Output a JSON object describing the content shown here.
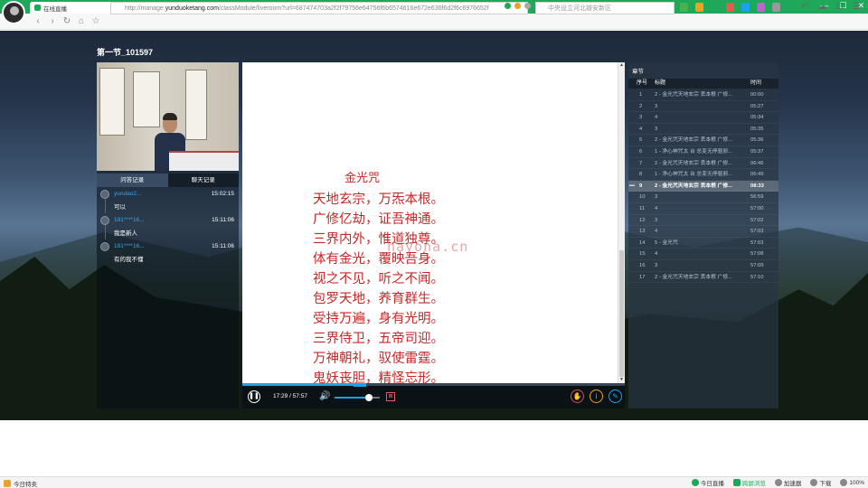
{
  "browser": {
    "tab_label": "在线直播",
    "tab_close": "×",
    "new_tab": "+",
    "url_prefix": "http://manage.",
    "url_domain": "yunduoketang.com",
    "url_rest": "/classModule/liveroom?url=687474703a2f2f79756e64756f6b6574616e672e636f6d2f6c6976652f",
    "search_text": "中央设立河北雄安新区",
    "nav": {
      "back": "‹",
      "forward": "›",
      "reload": "↻",
      "home": "⌂",
      "star": "☆"
    },
    "win_controls": {
      "min": "—",
      "max": "☐",
      "close": "✕"
    },
    "right_icons": {
      "undo": "↶",
      "cloud": "☁",
      "crop": "⊡",
      "menu": "☰"
    },
    "colors": {
      "brand": "#1fa85a"
    }
  },
  "course": {
    "title": "第一节_101597"
  },
  "chat": {
    "tabs": [
      {
        "label": "问答记录"
      },
      {
        "label": "聊天记录"
      }
    ],
    "messages": [
      {
        "user": "yundao2...",
        "time": "15:02:15",
        "text": "可以"
      },
      {
        "user": "181****16...",
        "time": "15:11:06",
        "text": "我是新人"
      },
      {
        "user": "181****16...",
        "time": "15:11:06",
        "text": "有的我不懂"
      }
    ]
  },
  "doc": {
    "title": "金光咒",
    "lines": [
      "天地玄宗，万炁本根。",
      "广修亿劫，证吾神通。",
      "三界内外，惟道独尊。",
      "体有金光，覆映吾身。",
      "视之不见，听之不闻。",
      "包罗天地，养育群生。",
      "受持万遍，身有光明。",
      "三界侍卫，五帝司迎。",
      "万神朝礼，驭使雷霆。",
      "鬼妖丧胆，精怪忘形。"
    ],
    "watermark": "hayona.cn",
    "scroll_up": "▲",
    "scroll_down": "▼"
  },
  "player": {
    "time": "17:29 / 57:57",
    "progress": 0.302,
    "volume": 0.75,
    "pause_glyph": "❚❚",
    "volume_glyph": "🔊",
    "cc_glyph": "⊠",
    "hand_glyph": "✋",
    "info_glyph": "i",
    "pen_glyph": "✎",
    "colors": {
      "accent": "#1aa3e8"
    }
  },
  "chapters": {
    "title": "章节",
    "headers": {
      "no": "序号",
      "title": "标题",
      "time": "时间"
    },
    "current_marker": "•••",
    "rows": [
      {
        "no": "1",
        "title": "2 - 金光咒天地玄宗 丢本根 广修...",
        "time": "00:00",
        "current": false
      },
      {
        "no": "2",
        "title": "3",
        "time": "05:27",
        "current": false
      },
      {
        "no": "3",
        "title": "4",
        "time": "05:34",
        "current": false
      },
      {
        "no": "4",
        "title": "3",
        "time": "05:35",
        "current": false
      },
      {
        "no": "5",
        "title": "2 - 金光咒天地玄宗 丢本根 广修...",
        "time": "05:36",
        "current": false
      },
      {
        "no": "6",
        "title": "1 - 净心神咒太 台 总变无停驱邪...",
        "time": "05:37",
        "current": false
      },
      {
        "no": "7",
        "title": "2 - 金光咒天地玄宗 丢本根 广修...",
        "time": "06:46",
        "current": false
      },
      {
        "no": "8",
        "title": "1 - 净心神咒太 台 总变无停驱邪...",
        "time": "06:49",
        "current": false
      },
      {
        "no": "9",
        "title": "2 - 金光咒天地玄宗 丢本根 广修...",
        "time": "08:33",
        "current": true
      },
      {
        "no": "10",
        "title": "3",
        "time": "56:59",
        "current": false
      },
      {
        "no": "11",
        "title": "4",
        "time": "57:00",
        "current": false
      },
      {
        "no": "12",
        "title": "3",
        "time": "57:02",
        "current": false
      },
      {
        "no": "13",
        "title": "4",
        "time": "57:03",
        "current": false
      },
      {
        "no": "14",
        "title": "5 - 金光咒",
        "time": "57:03",
        "current": false
      },
      {
        "no": "15",
        "title": "4",
        "time": "57:08",
        "current": false
      },
      {
        "no": "16",
        "title": "3",
        "time": "57:09",
        "current": false
      },
      {
        "no": "17",
        "title": "2 - 金光咒天地玄宗 丢本根 广修...",
        "time": "57:10",
        "current": false
      }
    ]
  },
  "statusbar": {
    "left": "今日特卖",
    "items": [
      "今日直播",
      "跨屏浏览",
      "加速器",
      "下载"
    ],
    "zoom": "100%"
  }
}
